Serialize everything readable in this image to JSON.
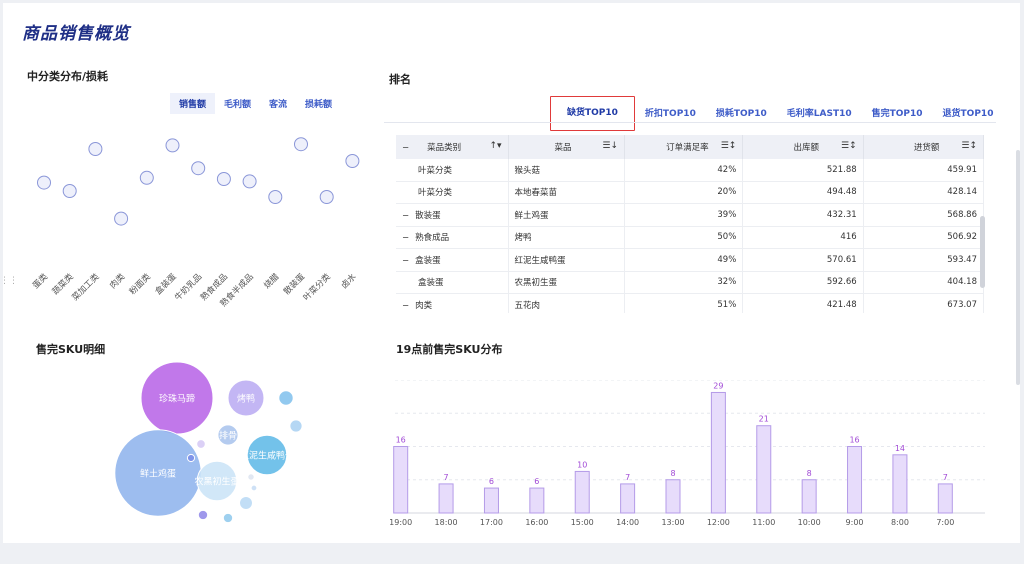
{
  "page": {
    "title": "商品销售概览"
  },
  "sections": {
    "left_top": "中分类分布/损耗",
    "right_top": "排名",
    "left_bottom": "售完SKU明细",
    "right_bottom": "19点前售完SKU分布"
  },
  "metric_tabs": [
    "销售额",
    "毛利额",
    "客流",
    "损耗额"
  ],
  "rank_tabs": [
    "缺货TOP10",
    "折扣TOP10",
    "损耗TOP10",
    "毛利率LAST10",
    "售完TOP10",
    "退货TOP10"
  ],
  "table": {
    "headers": [
      "菜品类别",
      "菜品",
      "订单满足率",
      "出库额",
      "进货额"
    ],
    "rows": [
      {
        "group": false,
        "category": "叶菜分类",
        "item": "猴头菇",
        "rate": "42%",
        "out": "521.88",
        "in": "459.91"
      },
      {
        "group": false,
        "category": "叶菜分类",
        "item": "本地春菜苗",
        "rate": "20%",
        "out": "494.48",
        "in": "428.14"
      },
      {
        "group": true,
        "category": "散装蛋",
        "item": "鲜土鸡蛋",
        "rate": "39%",
        "out": "432.31",
        "in": "568.86"
      },
      {
        "group": true,
        "category": "熟食成品",
        "item": "烤鸭",
        "rate": "50%",
        "out": "416",
        "in": "506.92"
      },
      {
        "group": true,
        "category": "盒装蛋",
        "item": "红泥生咸鸭蛋",
        "rate": "49%",
        "out": "570.61",
        "in": "593.47"
      },
      {
        "group": false,
        "category": "盒装蛋",
        "item": "农黑初生蛋",
        "rate": "32%",
        "out": "592.66",
        "in": "404.18"
      },
      {
        "group": true,
        "category": "肉类",
        "item": "五花肉",
        "rate": "51%",
        "out": "421.48",
        "in": "673.07"
      }
    ]
  },
  "scatter": {
    "categories": [
      "蛋类",
      "蔬菜类",
      "菜加工类",
      "肉类",
      "粉面类",
      "盒装蛋",
      "牛奶乳品",
      "熟食成品",
      "熟食半成品",
      "烧腊",
      "散装蛋",
      "叶菜分类",
      "卤水"
    ],
    "levels": [
      0.62,
      0.55,
      0.9,
      0.32,
      0.66,
      0.93,
      0.74,
      0.65,
      0.63,
      0.5,
      0.94,
      0.5,
      0.8
    ]
  },
  "bubbles": [
    {
      "label": "珍珠马蹄",
      "color": "#b660e6",
      "size": 1.0
    },
    {
      "label": "烤鸭",
      "color": "#b9a9f2",
      "size": 0.5
    },
    {
      "label": "排骨",
      "color": "#a7c2ec",
      "size": 0.28
    },
    {
      "label": "红泥生咸鸭蛋",
      "color": "#5bb7e6",
      "size": 0.55
    },
    {
      "label": "鲜土鸡蛋",
      "color": "#8cb2ec",
      "size": 1.2
    },
    {
      "label": "农黑初生蛋",
      "color": "#c9e3f7",
      "size": 0.55
    },
    {
      "label": "",
      "color": "#7fc0ec",
      "size": 0.2
    },
    {
      "label": "",
      "color": "#a8d0f2",
      "size": 0.17
    },
    {
      "label": "",
      "color": "#d5c8f4",
      "size": 0.12
    },
    {
      "label": "",
      "color": "#7b8ee8",
      "size": 0.1
    },
    {
      "label": "",
      "color": "#b7d8f4",
      "size": 0.18
    },
    {
      "label": "",
      "color": "#8e86e8",
      "size": 0.13
    },
    {
      "label": "",
      "color": "#8dc8ec",
      "size": 0.13
    },
    {
      "label": "",
      "color": "#dde4f0",
      "size": 0.09
    },
    {
      "label": "",
      "color": "#c6dcf5",
      "size": 0.08
    }
  ],
  "chart_data": {
    "type": "bar",
    "categories": [
      "19:00",
      "18:00",
      "17:00",
      "16:00",
      "15:00",
      "14:00",
      "13:00",
      "12:00",
      "11:00",
      "10:00",
      "9:00",
      "8:00",
      "7:00"
    ],
    "values": [
      16,
      7,
      6,
      6,
      10,
      7,
      8,
      29,
      21,
      8,
      16,
      14,
      7
    ],
    "ylim": [
      0,
      32
    ],
    "grid": true,
    "bar_color": "#e7dcfb",
    "bar_border": "#b49be8",
    "label_color": "#a14ad6"
  }
}
